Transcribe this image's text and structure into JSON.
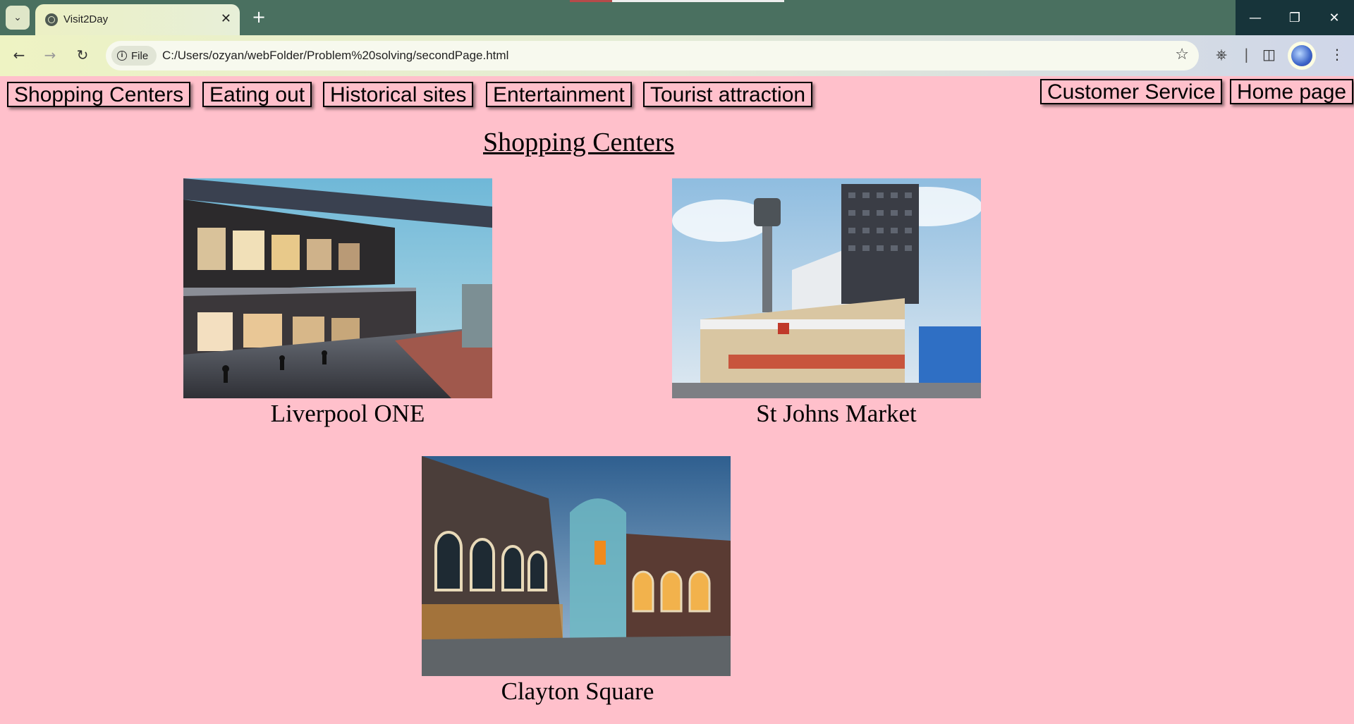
{
  "browser": {
    "tab_title": "Visit2Day",
    "site_info_label": "File",
    "url": "C:/Users/ozyan/webFolder/Problem%20solving/secondPage.html"
  },
  "nav": {
    "left_links": [
      "Shopping Centers",
      "Eating out",
      "Historical sites",
      "Entertainment",
      "Tourist attraction"
    ],
    "right_links": [
      "Customer Service",
      "Home page"
    ]
  },
  "page": {
    "heading": "Shopping Centers",
    "places": [
      {
        "caption": "Liverpool ONE"
      },
      {
        "caption": "St Johns Market"
      },
      {
        "caption": "Clayton Square"
      }
    ]
  },
  "colors": {
    "page_background": "#ffc0cb",
    "tab_bar": "#4a7060"
  }
}
